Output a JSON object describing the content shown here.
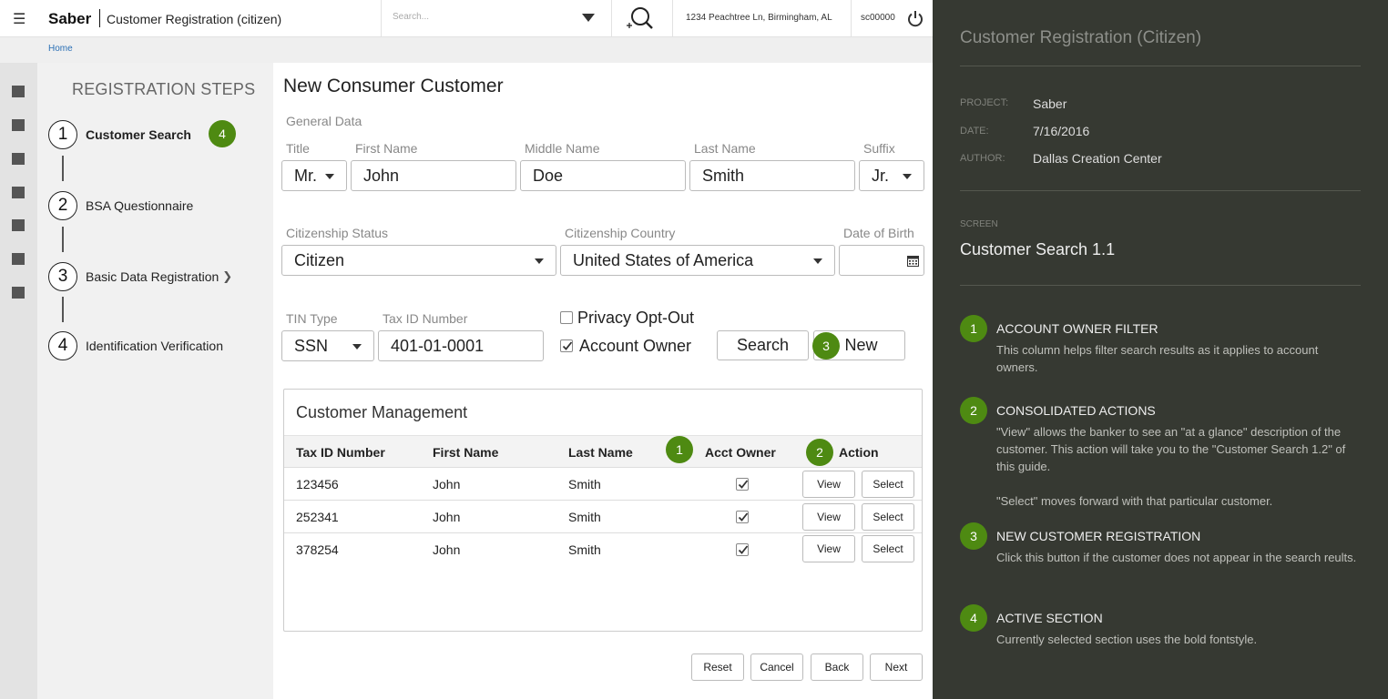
{
  "header": {
    "brand": "Saber",
    "app_title": "Customer Registration (citizen)",
    "search_placeholder": "Search...",
    "address": "1234 Peachtree Ln, Birmingham, AL",
    "user": "sc00000"
  },
  "breadcrumb": {
    "home": "Home"
  },
  "steps": {
    "title": "REGISTRATION STEPS",
    "items": [
      {
        "num": "1",
        "label": "Customer Search"
      },
      {
        "num": "2",
        "label": "BSA Questionnaire"
      },
      {
        "num": "3",
        "label": "Basic Data Registration"
      },
      {
        "num": "4",
        "label": "Identification Verification"
      }
    ]
  },
  "form": {
    "page_title": "New Consumer Customer",
    "section": "General Data",
    "title_label": "Title",
    "title_value": "Mr.",
    "first_label": "First Name",
    "first_value": "John",
    "middle_label": "Middle Name",
    "middle_value": "Doe",
    "last_label": "Last Name",
    "last_value": "Smith",
    "suffix_label": "Suffix",
    "suffix_value": "Jr.",
    "citizenship_label": "Citizenship Status",
    "citizenship_value": "Citizen",
    "country_label": "Citizenship Country",
    "country_value": "United States of America",
    "dob_label": "Date of Birth",
    "tin_type_label": "TIN Type",
    "tin_type_value": "SSN",
    "tax_id_label": "Tax ID Number",
    "tax_id_value": "401-01-0001",
    "privacy_label": "Privacy Opt-Out",
    "account_owner_label": "Account Owner",
    "search_button": "Search",
    "new_button": "New"
  },
  "table": {
    "title": "Customer Management",
    "columns": [
      "Tax ID Number",
      "First Name",
      "Last Name",
      "Acct Owner",
      "Action"
    ],
    "rows": [
      {
        "tax_id": "123456",
        "first": "John",
        "last": "Smith",
        "acct_owner": true
      },
      {
        "tax_id": "252341",
        "first": "John",
        "last": "Smith",
        "acct_owner": true
      },
      {
        "tax_id": "378254",
        "first": "John",
        "last": "Smith",
        "acct_owner": true
      }
    ],
    "view_label": "View",
    "select_label": "Select"
  },
  "footer": {
    "reset": "Reset",
    "cancel": "Cancel",
    "back": "Back",
    "next": "Next"
  },
  "badges": {
    "b1": "1",
    "b2": "2",
    "b3": "3",
    "b4": "4"
  },
  "panel": {
    "title": "Customer Registration (Citizen)",
    "project_key": "PROJECT:",
    "project": "Saber",
    "date_key": "DATE:",
    "date": "7/16/2016",
    "author_key": "AUTHOR:",
    "author": "Dallas Creation Center",
    "screen_key": "SCREEN",
    "screen": "Customer Search 1.1",
    "notes": [
      {
        "num": "1",
        "title": "ACCOUNT OWNER FILTER",
        "text": "This column helps filter search results as it applies to account owners."
      },
      {
        "num": "2",
        "title": "CONSOLIDATED ACTIONS",
        "text": "\"View\" allows the banker to see an \"at a glance\" description of the customer.  This action will take you to the \"Customer Search 1.2\" of this guide.",
        "text2": "\"Select\" moves forward with that particular customer."
      },
      {
        "num": "3",
        "title": "NEW CUSTOMER REGISTRATION",
        "text": "Click this button if the customer does not appear in the search reults."
      },
      {
        "num": "4",
        "title": "ACTIVE SECTION",
        "text": "Currently selected section uses the bold fontstyle."
      }
    ]
  },
  "colors": {
    "badge_green": "#4e8a12",
    "panel_bg": "#363932",
    "link_blue": "#2a6fb5"
  }
}
